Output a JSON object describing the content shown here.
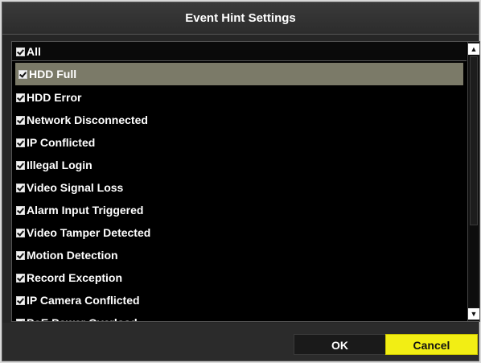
{
  "dialog": {
    "title": "Event Hint Settings",
    "all_label": "All",
    "items": [
      {
        "label": "HDD Full",
        "checked": true,
        "selected": true
      },
      {
        "label": "HDD Error",
        "checked": true
      },
      {
        "label": "Network Disconnected",
        "checked": true
      },
      {
        "label": "IP Conflicted",
        "checked": true
      },
      {
        "label": "Illegal Login",
        "checked": true
      },
      {
        "label": "Video Signal Loss",
        "checked": true
      },
      {
        "label": "Alarm Input Triggered",
        "checked": true
      },
      {
        "label": "Video Tamper Detected",
        "checked": true
      },
      {
        "label": "Motion Detection",
        "checked": true
      },
      {
        "label": "Record Exception",
        "checked": true
      },
      {
        "label": "IP Camera Conflicted",
        "checked": true
      },
      {
        "label": "PoE Power Overload",
        "checked": true
      }
    ],
    "ok_label": "OK",
    "cancel_label": "Cancel"
  },
  "colors": {
    "selected_row": "#7b7a68",
    "cancel_button": "#f2ee14"
  }
}
